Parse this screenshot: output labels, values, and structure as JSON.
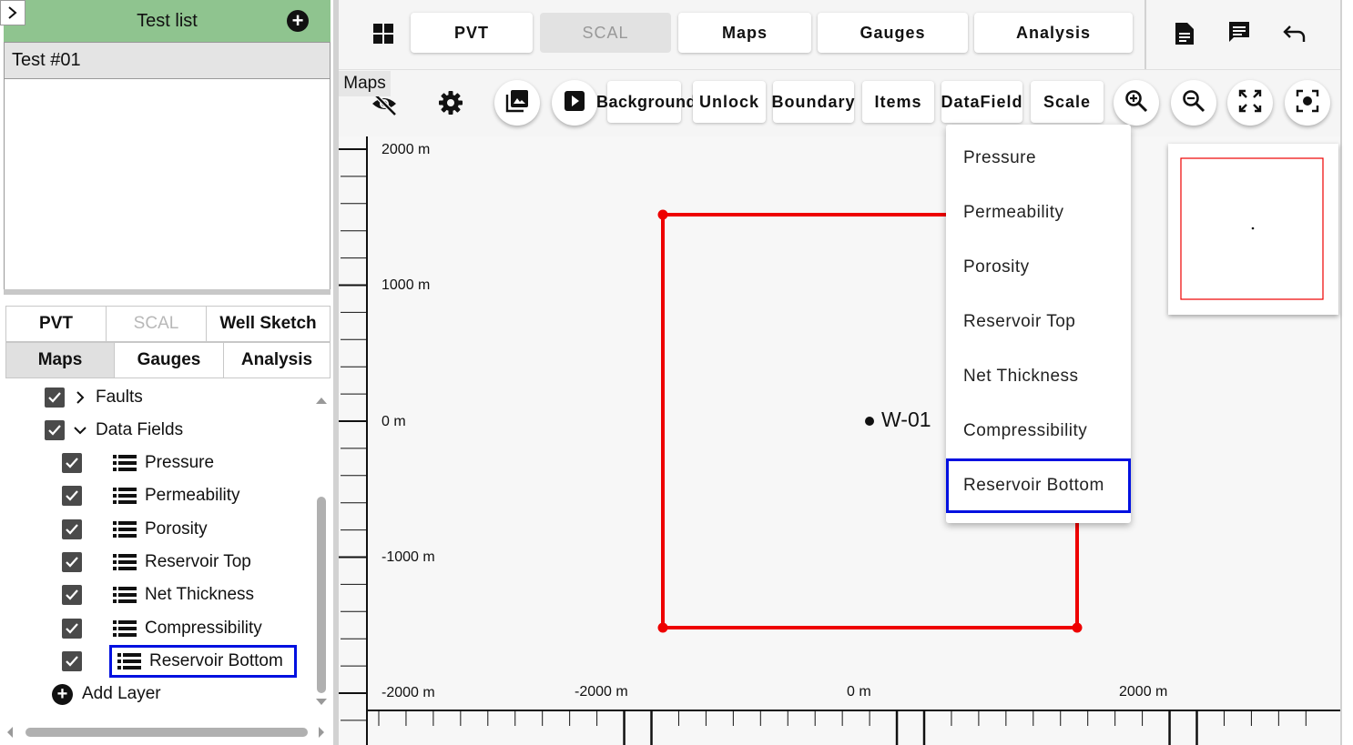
{
  "left_panel": {
    "test_list_title": "Test list",
    "tests": [
      "Test #01"
    ],
    "tabs_row1": [
      {
        "label": "PVT",
        "state": "normal"
      },
      {
        "label": "SCAL",
        "state": "disabled"
      },
      {
        "label": "Well Sketch",
        "state": "normal"
      }
    ],
    "tabs_row2": [
      {
        "label": "Maps",
        "state": "active"
      },
      {
        "label": "Gauges",
        "state": "normal"
      },
      {
        "label": "Analysis",
        "state": "normal"
      }
    ],
    "layers": {
      "faults": "Faults",
      "data_fields": "Data Fields",
      "fields": [
        "Pressure",
        "Permeability",
        "Porosity",
        "Reservoir Top",
        "Net Thickness",
        "Compressibility",
        "Reservoir Bottom"
      ],
      "add_layer": "Add Layer"
    }
  },
  "top_tabs": [
    {
      "label": "PVT",
      "state": "normal"
    },
    {
      "label": "SCAL",
      "state": "disabled"
    },
    {
      "label": "Maps",
      "state": "normal"
    },
    {
      "label": "Gauges",
      "state": "normal"
    },
    {
      "label": "Analysis",
      "state": "normal"
    }
  ],
  "top_icons": [
    "grid-icon",
    "document-icon",
    "comment-icon",
    "undo-icon"
  ],
  "map_toolbar": {
    "tooltip": "Maps",
    "buttons": [
      "Background",
      "Unlock",
      "Boundary",
      "Items",
      "DataField",
      "Scale"
    ],
    "icons": [
      "visibility-off-icon",
      "gear-icon",
      "image-icon",
      "play-icon",
      "zoom-in-icon",
      "zoom-out-icon",
      "fullscreen-icon",
      "center-focus-icon"
    ]
  },
  "datafield_menu": {
    "items": [
      "Pressure",
      "Permeability",
      "Porosity",
      "Reservoir Top",
      "Net Thickness",
      "Compressibility",
      "Reservoir Bottom"
    ],
    "highlighted": "Reservoir Bottom"
  },
  "map": {
    "y_labels": [
      "2000 m",
      "1000 m",
      "0 m",
      "-1000 m",
      "-2000 m"
    ],
    "x_labels": [
      "-2000 m",
      "0 m",
      "2000 m"
    ],
    "well_label": "W-01",
    "boundary_color": "#ee0000",
    "highlight_color": "#0010e0"
  }
}
